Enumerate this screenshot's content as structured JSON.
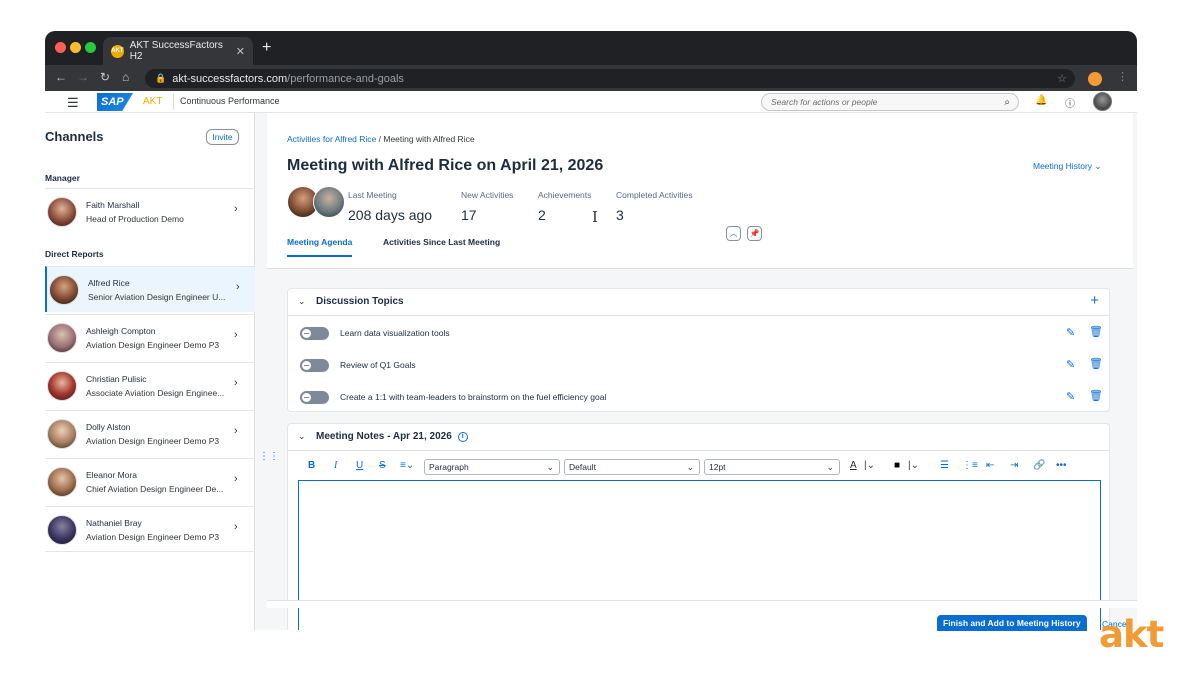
{
  "browser": {
    "tab_title": "AKT SuccessFactors H2",
    "tab_favicon": "AKT",
    "tab_close": "✕",
    "new_tab": "+",
    "url_host": "akt-successfactors.com",
    "url_path": "/performance-and-goals"
  },
  "shell": {
    "brand_sap": "SAP",
    "brand_akt": "AKT",
    "title": "Continuous Performance",
    "search_placeholder": "Search for actions or people"
  },
  "sidebar": {
    "title": "Channels",
    "invite_label": "Invite",
    "manager_section": "Manager",
    "reports_section": "Direct Reports",
    "manager": {
      "name": "Faith Marshall",
      "role": "Head of Production Demo"
    },
    "reports": [
      {
        "name": "Alfred Rice",
        "role": "Senior Aviation Design Engineer U..."
      },
      {
        "name": "Ashleigh Compton",
        "role": "Aviation Design Engineer Demo P3"
      },
      {
        "name": "Christian Pulisic",
        "role": "Associate Aviation Design Enginee..."
      },
      {
        "name": "Dolly Alston",
        "role": "Aviation Design Engineer Demo P3"
      },
      {
        "name": "Eleanor Mora",
        "role": "Chief Aviation Design Engineer De..."
      },
      {
        "name": "Nathaniel Bray",
        "role": "Aviation Design Engineer Demo P3"
      }
    ]
  },
  "header": {
    "breadcrumb_link": "Activities for Alfred Rice",
    "breadcrumb_sep": " / ",
    "breadcrumb_current": "Meeting with Alfred Rice",
    "title": "Meeting with Alfred Rice on April 21, 2026",
    "history_link": "Meeting History",
    "kpis": [
      {
        "label": "Last Meeting",
        "value": "208 days ago"
      },
      {
        "label": "New Activities",
        "value": "17"
      },
      {
        "label": "Achievements",
        "value": "2"
      },
      {
        "label": "Completed Activities",
        "value": "3"
      }
    ],
    "tabs": [
      "Meeting Agenda",
      "Activities Since Last Meeting"
    ]
  },
  "discussion": {
    "title": "Discussion Topics",
    "topics": [
      "Learn data visualization tools",
      "Review of Q1 Goals",
      "Create a 1:1 with team-leaders to brainstorm on the fuel efficiency goal"
    ]
  },
  "notes": {
    "title": "Meeting Notes - Apr 21, 2026",
    "toolbar": {
      "bold": "B",
      "italic": "I",
      "underline": "U",
      "strike": "S",
      "block_format": "Paragraph",
      "font_family": "Default",
      "font_size": "12pt",
      "font_color": "A",
      "more": "•••"
    }
  },
  "footer": {
    "finish_label": "Finish and Add to Meeting History",
    "cancel_label": "Cance"
  },
  "watermark": "akt",
  "colors": {
    "accent": "#0a6ed1",
    "brand_orange": "#f29b34",
    "sap_gold": "#f0ab00"
  }
}
